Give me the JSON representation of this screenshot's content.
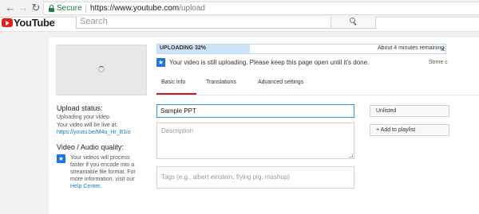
{
  "browser": {
    "secure_label": "Secure",
    "url_host": "https://www.youtube.com",
    "url_path": "/upload"
  },
  "header": {
    "logo_text": "YouTube",
    "search_placeholder": "Search"
  },
  "upload": {
    "thumbnail_icon": "loading-spinner",
    "progress_label": "UPLOADING 32%",
    "progress_fraction": 0.32,
    "time_remaining": "About 4 minutes remaining.",
    "notice": "Your video is still uploading. Please keep this page open until it's done.",
    "notice_cutoff": "Some c",
    "status_heading": "Upload status:",
    "status_text": "Uploading your video.",
    "live_text": "Your video will be live at:",
    "live_link": "https://youtu.be/M4u_Hr_B1io",
    "quality_heading": "Video / Audio quality:",
    "quality_text": "Your videos will process faster if you encode into a streamable file format. For more information, visit our",
    "help_link": "Help Center."
  },
  "tabs": [
    {
      "label": "Basic info",
      "active": true
    },
    {
      "label": "Translations",
      "active": false
    },
    {
      "label": "Advanced settings",
      "active": false
    }
  ],
  "form": {
    "title_value": "Sample PPT",
    "description_placeholder": "Description",
    "tags_placeholder": "Tags (e.g., albert einstein, flying pig, mashup)",
    "privacy_value": "Unlisted",
    "playlist_label": "+ Add to playlist"
  },
  "colors": {
    "accent_blue": "#1a73e8",
    "tab_red": "#cc181e",
    "link_blue": "#167ac6",
    "secure_green": "#188038"
  }
}
